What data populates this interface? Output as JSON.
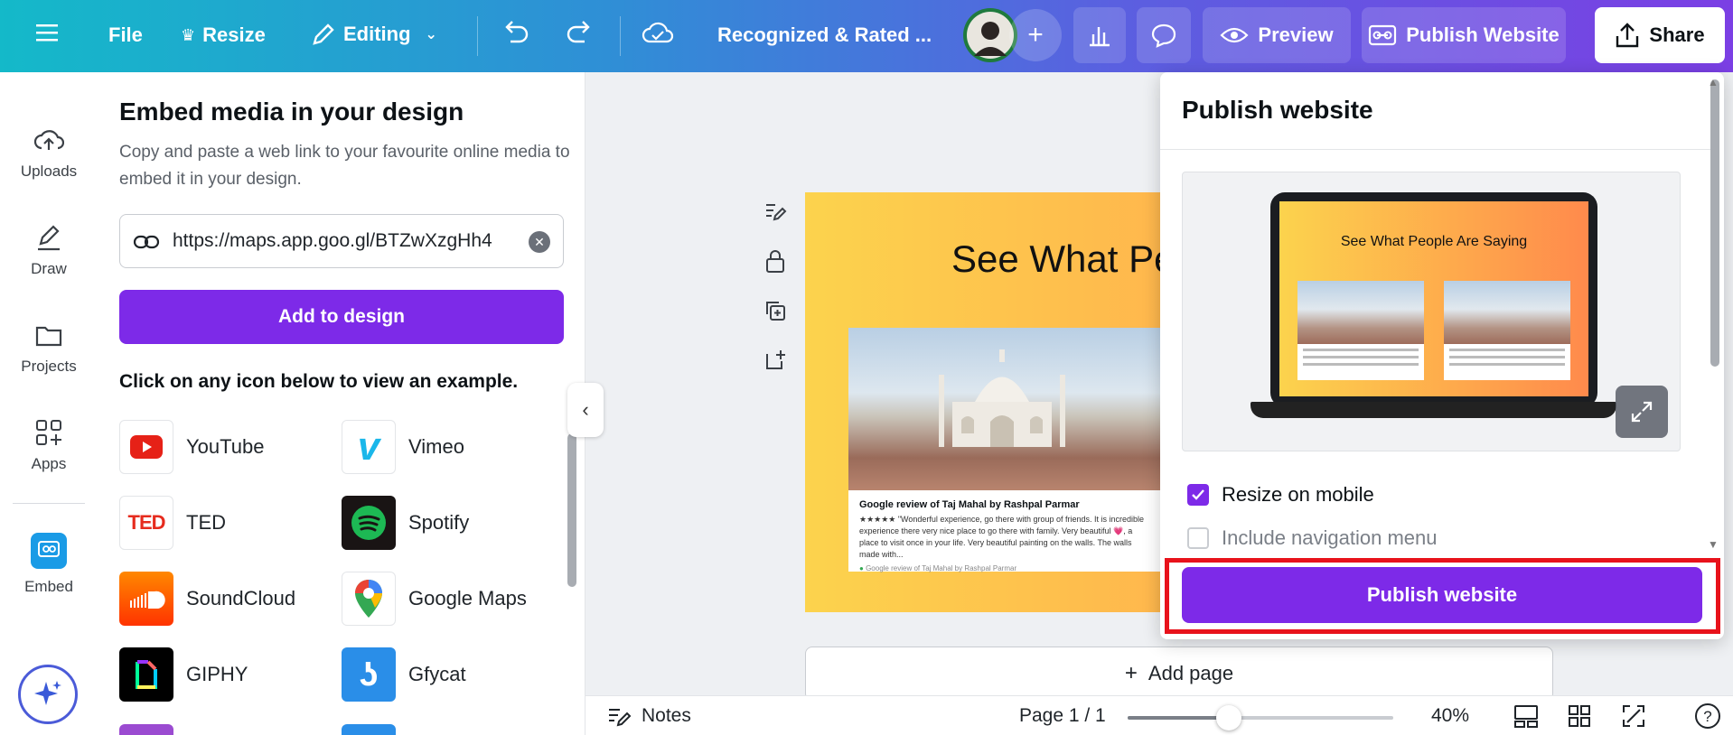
{
  "topbar": {
    "file": "File",
    "resize": "Resize",
    "editing": "Editing",
    "title": "Recognized & Rated ...",
    "preview": "Preview",
    "publish": "Publish Website",
    "share": "Share"
  },
  "rail": {
    "uploads": "Uploads",
    "draw": "Draw",
    "projects": "Projects",
    "apps": "Apps",
    "embed": "Embed"
  },
  "panel": {
    "title": "Embed media in your design",
    "description": "Copy and paste a web link to your favourite online media to embed it in your design.",
    "url_value": "https://maps.app.goo.gl/BTZwXzgHh4",
    "add_button": "Add to design",
    "subtitle": "Click on any icon below to view an example.",
    "media": [
      {
        "label": "YouTube",
        "icon": "youtube-icon"
      },
      {
        "label": "Vimeo",
        "icon": "vimeo-icon"
      },
      {
        "label": "TED",
        "icon": "ted-icon"
      },
      {
        "label": "Spotify",
        "icon": "spotify-icon"
      },
      {
        "label": "SoundCloud",
        "icon": "soundcloud-icon"
      },
      {
        "label": "Google Maps",
        "icon": "google-maps-icon"
      },
      {
        "label": "GIPHY",
        "icon": "giphy-icon"
      },
      {
        "label": "Gfycat",
        "icon": "gfycat-icon"
      }
    ],
    "ted_logo": "TED"
  },
  "canvas": {
    "page_title": "See What People Are Saying",
    "card_heading": "Google review of Taj Mahal by Rashpal Parmar",
    "card_text": "★★★★★ \"Wonderful experience, go there with group of friends. It is incredible experience there very nice place to go there with family. Very beautiful 💗, a place to visit once in your life. Very beautiful painting on the walls. The walls made with...",
    "card_source": "Google review of Taj Mahal by Rashpal Parmar",
    "add_page": "Add page"
  },
  "bottombar": {
    "notes": "Notes",
    "page": "Page 1 / 1",
    "zoom": "40%",
    "zoom_level": 0.38
  },
  "publish_popup": {
    "title": "Publish website",
    "preview_title": "See What People Are Saying",
    "resize_mobile": "Resize on mobile",
    "resize_mobile_checked": true,
    "nav_menu": "Include navigation menu",
    "nav_menu_checked": false,
    "publish_button": "Publish website"
  },
  "colors": {
    "accent": "#7d2ae8",
    "highlight": "#e8121b"
  }
}
